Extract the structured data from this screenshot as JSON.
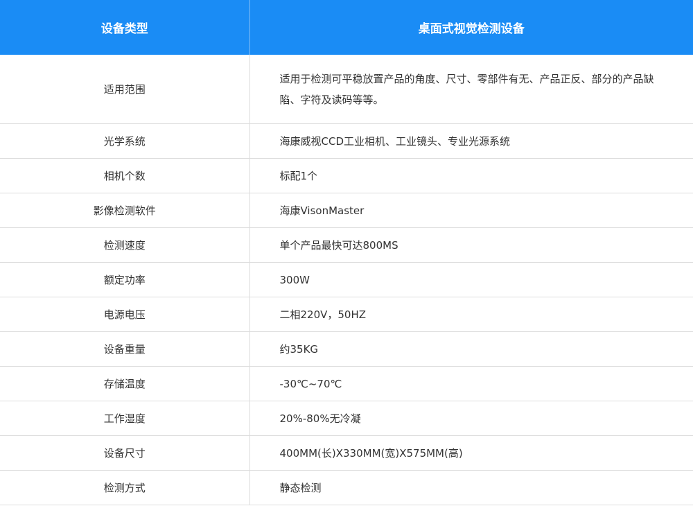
{
  "header": {
    "col1": "设备类型",
    "col2": "桌面式视觉检测设备"
  },
  "rows": [
    {
      "label": "适用范围",
      "value": "适用于检测可平稳放置产品的角度、尺寸、零部件有无、产品正反、部分的产品缺陷、字符及读码等等。"
    },
    {
      "label": "光学系统",
      "value": "海康威视CCD工业相机、工业镜头、专业光源系统"
    },
    {
      "label": "相机个数",
      "value": "标配1个"
    },
    {
      "label": "影像检测软件",
      "value": "海康VisonMaster"
    },
    {
      "label": "检测速度",
      "value": "单个产品最快可达800MS"
    },
    {
      "label": "额定功率",
      "value": "300W"
    },
    {
      "label": "电源电压",
      "value": "二相220V，50HZ"
    },
    {
      "label": "设备重量",
      "value": "约35KG"
    },
    {
      "label": "存储温度",
      "value": "-30℃~70℃"
    },
    {
      "label": "工作湿度",
      "value": "20%-80%无冷凝"
    },
    {
      "label": "设备尺寸",
      "value": "400MM(长)X330MM(宽)X575MM(高)"
    },
    {
      "label": "检测方式",
      "value": "静态检测"
    }
  ],
  "colors": {
    "header_bg": "#1a8cf5",
    "header_text": "#ffffff",
    "border": "#dcdcdc",
    "body_text": "#333333"
  }
}
